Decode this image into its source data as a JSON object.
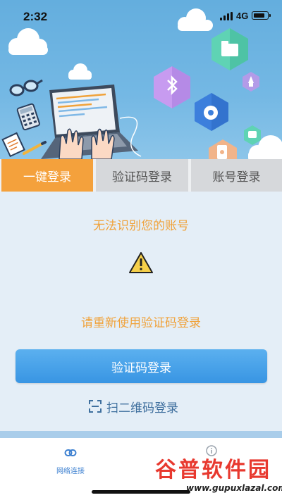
{
  "status_bar": {
    "time": "2:32",
    "network": "4G"
  },
  "tabs": [
    {
      "label": "一键登录",
      "active": true
    },
    {
      "label": "验证码登录",
      "active": false
    },
    {
      "label": "账号登录",
      "active": false
    }
  ],
  "main": {
    "error_message": "无法识别您的账号",
    "hint_message": "请重新使用验证码登录",
    "primary_button": "验证码登录",
    "qr_link": "扫二维码登录"
  },
  "bottom_nav": [
    {
      "label": "网络连接",
      "icon": "link-icon"
    },
    {
      "label": "",
      "icon": "info-icon"
    }
  ],
  "watermark": {
    "title": "谷普软件园",
    "url": "www.gupuxlazal.com"
  },
  "colors": {
    "accent_orange": "#f4a13c",
    "message_orange": "#f0a23a",
    "primary_blue": "#3895e3",
    "hero_blue": "#6ab2e1"
  }
}
